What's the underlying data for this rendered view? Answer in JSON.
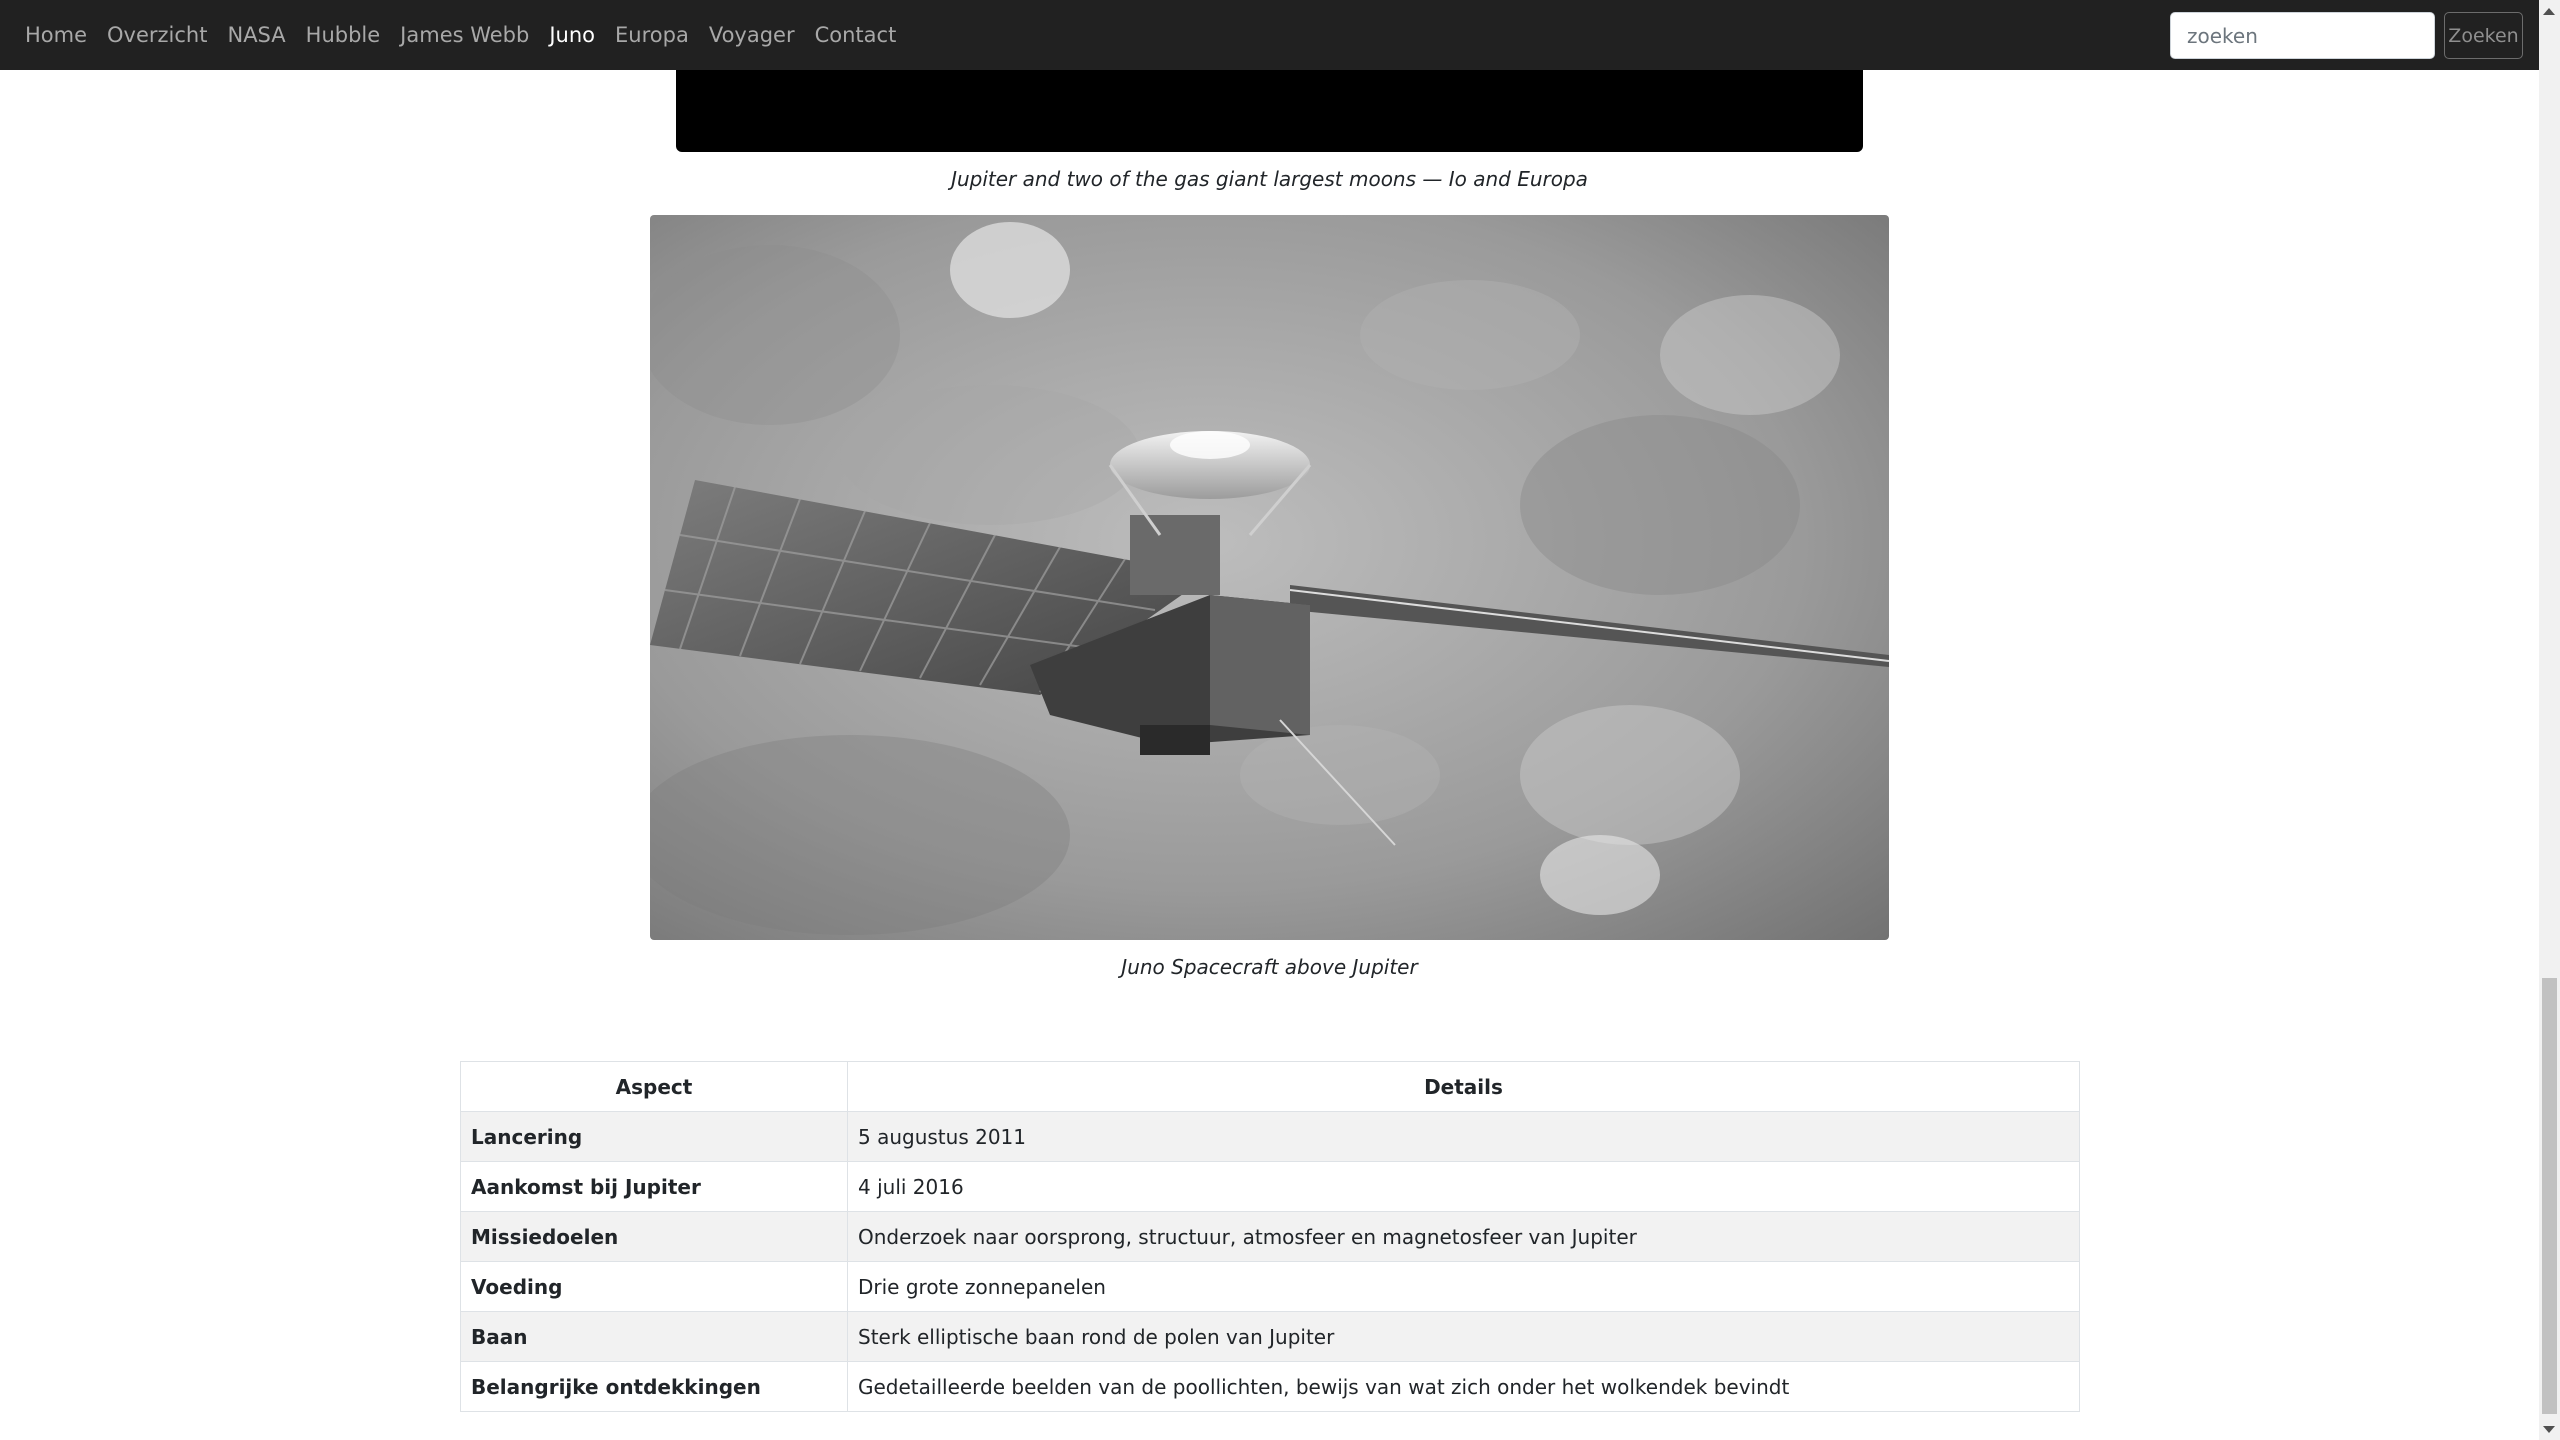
{
  "nav": {
    "links": [
      {
        "label": "Home",
        "active": false
      },
      {
        "label": "Overzicht",
        "active": false
      },
      {
        "label": "NASA",
        "active": false
      },
      {
        "label": "Hubble",
        "active": false
      },
      {
        "label": "James Webb",
        "active": false
      },
      {
        "label": "Juno",
        "active": true
      },
      {
        "label": "Europa",
        "active": false
      },
      {
        "label": "Voyager",
        "active": false
      },
      {
        "label": "Contact",
        "active": false
      }
    ],
    "search": {
      "placeholder": "zoeken",
      "button_label": "Zoeken"
    }
  },
  "media": {
    "video_caption": "Jupiter and two of the gas giant largest moons — Io and Europa",
    "image_caption": "Juno Spacecraft above Jupiter"
  },
  "table": {
    "headers": [
      "Aspect",
      "Details"
    ],
    "rows": [
      {
        "aspect": "Lancering",
        "details": "5 augustus 2011"
      },
      {
        "aspect": "Aankomst bij Jupiter",
        "details": "4 juli 2016"
      },
      {
        "aspect": "Missiedoelen",
        "details": "Onderzoek naar oorsprong, structuur, atmosfeer en magnetosfeer van Jupiter"
      },
      {
        "aspect": "Voeding",
        "details": "Drie grote zonnepanelen"
      },
      {
        "aspect": "Baan",
        "details": "Sterk elliptische baan rond de polen van Jupiter"
      },
      {
        "aspect": "Belangrijke ontdekkingen",
        "details": "Gedetailleerde beelden van de poollichten, bewijs van wat zich onder het wolkendek bevindt"
      }
    ]
  },
  "colors": {
    "navbar_bg": "#212121",
    "nav_link": "#a8a8a8",
    "nav_link_active": "#ffffff",
    "table_stripe": "#f2f2f2"
  }
}
